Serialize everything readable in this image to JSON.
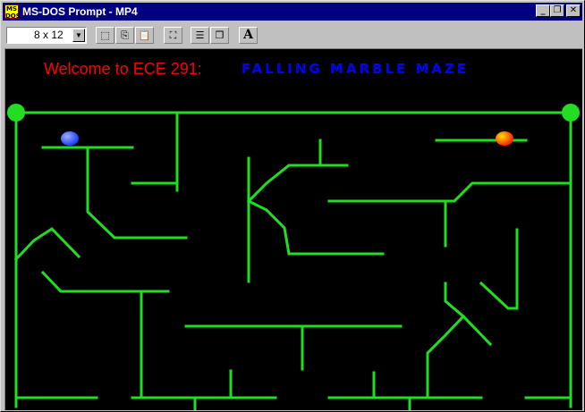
{
  "window": {
    "title": "MS-DOS Prompt - MP4",
    "icon_name": "ms-dos-icon",
    "icon_text": "MS DOS",
    "minimize_glyph": "_",
    "maximize_glyph": "❐",
    "close_glyph": "✕"
  },
  "toolbar": {
    "font_size_value": "8 x 12",
    "dropdown_glyph": "▼",
    "tools": [
      {
        "name": "mark-icon",
        "glyph": "⬚"
      },
      {
        "name": "copy-icon",
        "glyph": "⎘"
      },
      {
        "name": "paste-icon",
        "glyph": "📋"
      },
      {
        "name": "fullscreen-icon",
        "glyph": "⛶"
      },
      {
        "name": "properties-icon",
        "glyph": "☰"
      },
      {
        "name": "background-icon",
        "glyph": "❐"
      },
      {
        "name": "font-icon",
        "glyph": "A"
      }
    ]
  },
  "console": {
    "welcome_text": "Welcome to ECE 291:",
    "game_title": "FALLING MARBLE MAZE"
  },
  "colors": {
    "maze_wall": "#22dd22",
    "welcome_text": "#ff0000",
    "game_title": "#0000ff",
    "blue_marble": "#1a3cff",
    "red_marble": "#ff2200",
    "background": "#000000"
  }
}
